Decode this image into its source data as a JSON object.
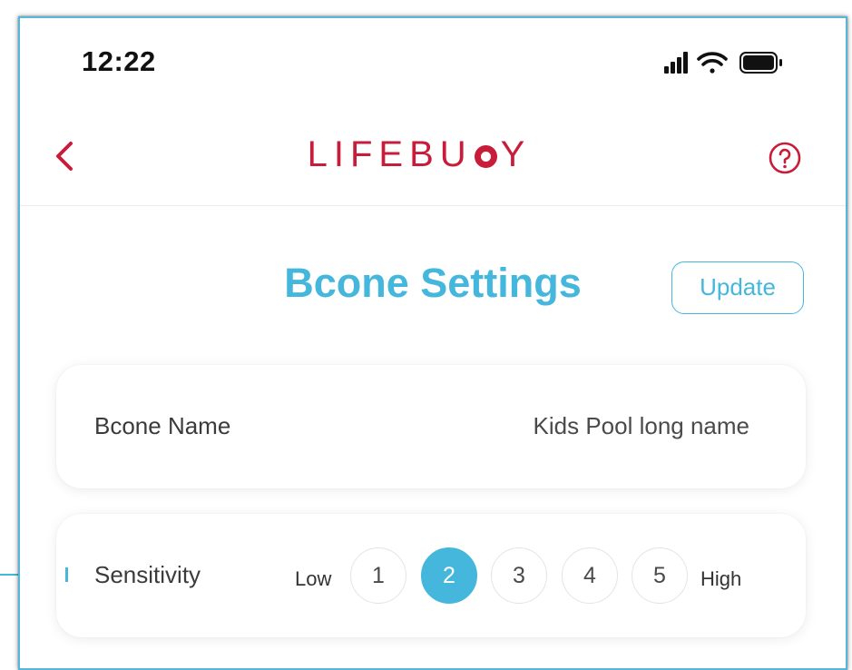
{
  "status_bar": {
    "time": "12:22",
    "icons": [
      "signal-icon",
      "wifi-icon",
      "battery-icon"
    ]
  },
  "nav": {
    "back_icon": "chevron-left-icon",
    "logo": {
      "prefix": "LIFEBU",
      "suffix": "Y"
    },
    "help_icon": "help-circle-icon"
  },
  "page": {
    "title": "Bcone Settings",
    "update_label": "Update"
  },
  "settings": {
    "name": {
      "label": "Bcone Name",
      "value": "Kids Pool long name"
    },
    "sensitivity": {
      "label": "Sensitivity",
      "low_label": "Low",
      "high_label": "High",
      "options": [
        "1",
        "2",
        "3",
        "4",
        "5"
      ],
      "selected": "2"
    }
  },
  "colors": {
    "accent": "#45b7dc",
    "brand": "#c81d3a",
    "text": "#3b3b3b"
  }
}
